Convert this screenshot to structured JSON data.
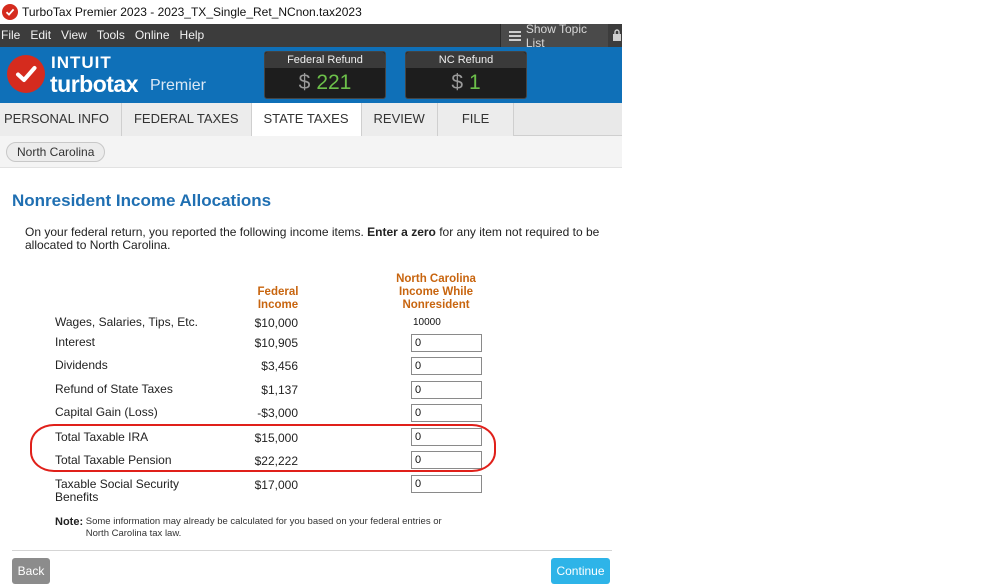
{
  "window": {
    "title": "TurboTax Premier 2023 - 2023_TX_Single_Ret_NCnon.tax2023"
  },
  "menu": {
    "items": [
      "File",
      "Edit",
      "View",
      "Tools",
      "Online",
      "Help"
    ],
    "show_topic_list": "Show Topic List"
  },
  "header": {
    "brand": "INTUIT",
    "product": "turbotax",
    "edition": "Premier",
    "federal_refund_label": "Federal Refund",
    "federal_refund_currency": "$",
    "federal_refund_value": "221",
    "nc_refund_label": "NC Refund",
    "nc_refund_currency": "$",
    "nc_refund_value": "1",
    "refund_color": "#6cc04a"
  },
  "tabs": [
    "PERSONAL INFO",
    "FEDERAL TAXES",
    "STATE TAXES",
    "REVIEW",
    "FILE"
  ],
  "active_tab": "STATE TAXES",
  "state_chip": "North Carolina",
  "page": {
    "title": "Nonresident Income Allocations",
    "intro_before": "On your federal return, you reported the following income items. ",
    "intro_bold": "Enter a zero",
    "intro_after": " for any item not required to be allocated to North Carolina.",
    "col_federal": "Federal Income",
    "col_nc": "North Carolina Income While Nonresident"
  },
  "rows": [
    {
      "label": "Wages, Salaries, Tips, Etc.",
      "federal": "$10,000",
      "nc": "10000",
      "editable": false
    },
    {
      "label": "Interest",
      "federal": "$10,905",
      "nc": "0",
      "editable": true
    },
    {
      "label": "Dividends",
      "federal": "$3,456",
      "nc": "0",
      "editable": true
    },
    {
      "label": "Refund of State Taxes",
      "federal": "$1,137",
      "nc": "0",
      "editable": true
    },
    {
      "label": "Capital Gain (Loss)",
      "federal": "-$3,000",
      "nc": "0",
      "editable": true
    },
    {
      "label": "Total Taxable IRA",
      "federal": "$15,000",
      "nc": "0",
      "editable": true
    },
    {
      "label": "Total Taxable Pension",
      "federal": "$22,222",
      "nc": "0",
      "editable": true
    },
    {
      "label": "Taxable Social Security Benefits",
      "federal": "$17,000",
      "nc": "0",
      "editable": true
    }
  ],
  "note": {
    "label": "Note:",
    "text": "Some information may already be calculated for you based on your federal entries or North Carolina tax law."
  },
  "buttons": {
    "back": "Back",
    "continue": "Continue"
  },
  "colors": {
    "header_blue": "#0f70b8",
    "title_blue": "#1f6fb2",
    "column_orange": "#c8650f",
    "highlight_red": "#e0201a",
    "continue_blue": "#2eb4e8"
  }
}
